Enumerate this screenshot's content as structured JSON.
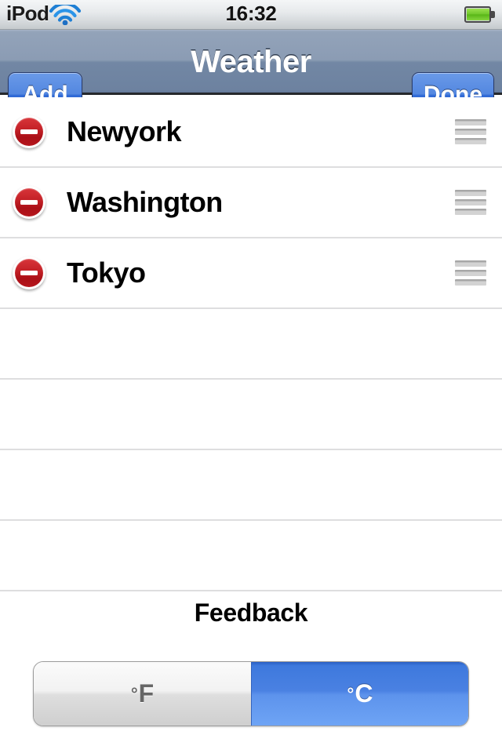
{
  "status_bar": {
    "carrier": "iPod",
    "time": "16:32",
    "wifi_icon": "wifi-icon",
    "battery_icon": "battery-full-icon"
  },
  "nav_bar": {
    "title": "Weather",
    "add_label": "Add",
    "done_label": "Done"
  },
  "list": {
    "rows": [
      {
        "label": "Newyork",
        "delete_icon": "delete-minus-icon",
        "reorder_icon": "reorder-handle-icon"
      },
      {
        "label": "Washington",
        "delete_icon": "delete-minus-icon",
        "reorder_icon": "reorder-handle-icon"
      },
      {
        "label": "Tokyo",
        "delete_icon": "delete-minus-icon",
        "reorder_icon": "reorder-handle-icon"
      }
    ],
    "empty_rows": 4
  },
  "feedback": {
    "title": "Feedback",
    "segments": [
      {
        "label": "F",
        "degree": "°",
        "selected": false
      },
      {
        "label": "C",
        "degree": "°",
        "selected": true
      }
    ],
    "selected_unit": "°C"
  },
  "colors": {
    "nav_bar_top": "#93a3b9",
    "nav_bar_bottom": "#64799a",
    "button_blue": "#3973dd",
    "delete_red": "#c52228",
    "selected_segment_blue": "#4a81e2",
    "separator_gray": "#dededf",
    "battery_green": "#6fc72b"
  }
}
